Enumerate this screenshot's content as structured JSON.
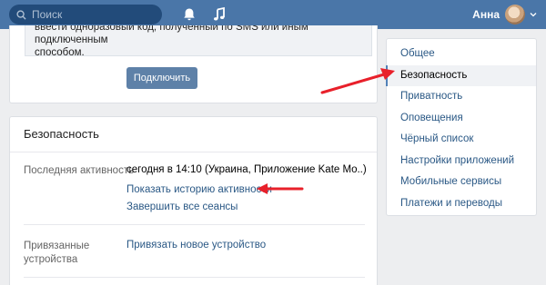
{
  "header": {
    "search_placeholder": "Поиск",
    "bell_icon": "bell-icon",
    "music_icon": "music-icon",
    "user_name": "Анна",
    "colors": {
      "bar": "#4a76a8",
      "search_bg": "#224b7a"
    }
  },
  "two_factor": {
    "notice_lines": [
      "ввести одноразовый код, полученный по SMS или иным подключенным",
      "способом."
    ],
    "connect_button": "Подключить"
  },
  "security": {
    "title": "Безопасность",
    "last_activity_label": "Последняя активность",
    "last_activity_value": "сегодня в 14:10 (Украина, Приложение Kate Mo..)",
    "show_history_link": "Показать историю активности",
    "end_sessions_link": "Завершить все сеансы",
    "linked_devices_label_1": "Привязанные",
    "linked_devices_label_2": "устройства",
    "link_device_link": "Привязать новое устройство"
  },
  "menu": {
    "items": [
      {
        "label": "Общее",
        "active": false
      },
      {
        "label": "Безопасность",
        "active": true
      },
      {
        "label": "Приватность",
        "active": false
      },
      {
        "label": "Оповещения",
        "active": false
      },
      {
        "label": "Чёрный список",
        "active": false
      },
      {
        "label": "Настройки приложений",
        "active": false
      },
      {
        "label": "Мобильные сервисы",
        "active": false
      },
      {
        "label": "Платежи и переводы",
        "active": false
      }
    ]
  },
  "annotations": {
    "arrow_color": "#e8202a"
  }
}
